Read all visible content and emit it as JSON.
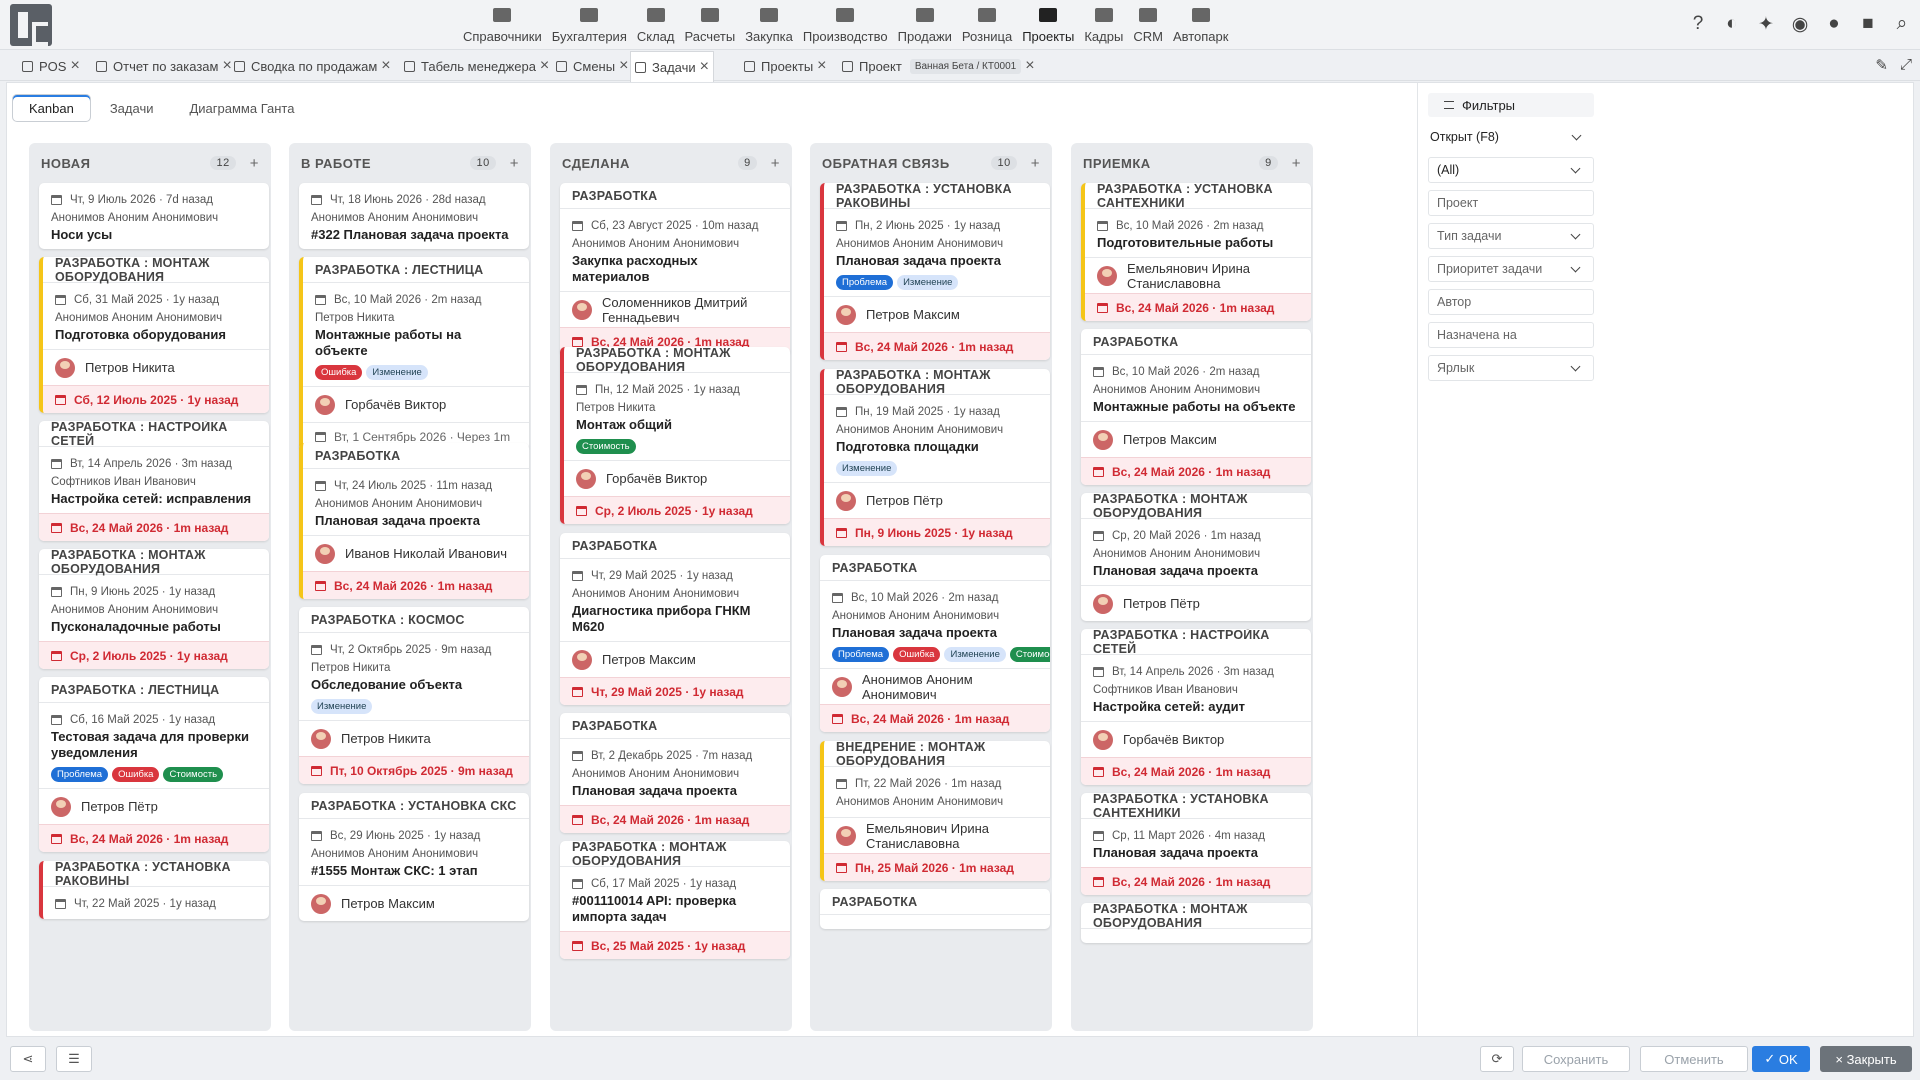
{
  "nav": {
    "modules": [
      {
        "label": "Справочники",
        "icon": "list-icon"
      },
      {
        "label": "Бухгалтерия",
        "icon": "ledger-icon"
      },
      {
        "label": "Склад",
        "icon": "warehouse-icon"
      },
      {
        "label": "Расчеты",
        "icon": "money-icon"
      },
      {
        "label": "Закупка",
        "icon": "truck-icon"
      },
      {
        "label": "Производство",
        "icon": "factory-icon"
      },
      {
        "label": "Продажи",
        "icon": "hand-money-icon"
      },
      {
        "label": "Розница",
        "icon": "bag-icon"
      },
      {
        "label": "Проекты",
        "icon": "project-icon",
        "active": true
      },
      {
        "label": "Кадры",
        "icon": "fingerprint-icon"
      },
      {
        "label": "CRM",
        "icon": "crm-icon"
      },
      {
        "label": "Автопарк",
        "icon": "bus-icon"
      }
    ],
    "tools": [
      "help-icon",
      "contrast-icon",
      "pin-icon",
      "eye-icon",
      "chat-icon",
      "lock-icon",
      "search-icon"
    ]
  },
  "tabs": [
    {
      "label": "POS"
    },
    {
      "label": "Отчет по заказам"
    },
    {
      "label": "Сводка по продажам"
    },
    {
      "label": "Табель менеджера"
    },
    {
      "label": "Смены"
    },
    {
      "label": "Задачи",
      "active": true
    },
    {
      "label": "Проекты"
    },
    {
      "label": "Проект",
      "badge": "Ванная Бета / КТ0001"
    }
  ],
  "views": {
    "kanban": "Kanban",
    "tasks": "Задачи",
    "gantt": "Диаграмма Ганта"
  },
  "columns": [
    {
      "title": "НОВАЯ",
      "count": "12",
      "add": "+",
      "cards": [
        {
          "type": "",
          "date": "Чт, 9 Июль 2026 · 7d назад",
          "author": "Анонимов Аноним Анонимович",
          "name": "Носи усы"
        },
        {
          "type": "РАЗРАБОТКА : МОНТАЖ ОБОРУДОВАНИЯ",
          "border": "yellow",
          "date": "Сб, 31 Май 2025 · 1y назад",
          "author": "Анонимов Аноним Анонимович",
          "name": "Подготовка оборудования",
          "assignee": "Петров Никита",
          "due": "Сб, 12 Июль 2025 · 1y назад"
        },
        {
          "type": "РАЗРАБОТКА : НАСТРОЙКА СЕТЕЙ",
          "date": "Вт, 14 Апрель 2026 · 3m назад",
          "author": "Софтников Иван Иванович",
          "name": "Настройка сетей: исправления",
          "due": "Вс, 24 Май 2026 · 1m назад"
        },
        {
          "type": "РАЗРАБОТКА : МОНТАЖ ОБОРУДОВАНИЯ",
          "date": "Пн, 9 Июнь 2025 · 1y назад",
          "author": "Анонимов Аноним Анонимович",
          "name": "Пусконаладочные работы",
          "due": "Ср, 2 Июль 2025 · 1y назад"
        },
        {
          "type": "РАЗРАБОТКА : ЛЕСТНИЦА",
          "date": "Сб, 16 Май 2025 · 1y назад",
          "author": "",
          "name": "Тестовая задача для проверки уведомления",
          "tags": [
            "Проблема",
            "Ошибка",
            "Стоимость"
          ],
          "assignee": "Петров Пётр",
          "due": "Вс, 24 Май 2026 · 1m назад"
        },
        {
          "type": "РАЗРАБОТКА : УСТАНОВКА РАКОВИНЫ",
          "border": "red",
          "date": "Чт, 22 Май 2025 · 1y назад",
          "author": "",
          "name": ""
        }
      ]
    },
    {
      "title": "В РАБОТЕ",
      "count": "10",
      "add": "+",
      "cards": [
        {
          "type": "",
          "date": "Чт, 18 Июнь 2026 · 28d назад",
          "author": "Анонимов Аноним Анонимович",
          "name": "#322 Плановая задача проекта"
        },
        {
          "type": "РАЗРАБОТКА : ЛЕСТНИЦА",
          "border": "yellow",
          "date": "Вс, 10 Май 2026 · 2m назад",
          "author": "Петров Никита",
          "name": "Монтажные работы на объекте",
          "tags": [
            "Ошибка",
            "Изменение"
          ],
          "assignee": "Горбачёв Виктор",
          "plan": "Вт, 1 Сентябрь 2026 · Через 1m"
        },
        {
          "type": "РАЗРАБОТКА",
          "border": "yellow",
          "date": "Чт, 24 Июль 2025 · 11m назад",
          "author": "Анонимов Аноним Анонимович",
          "name": "Плановая задача проекта",
          "assignee": "Иванов Николай Иванович",
          "due": "Вс, 24 Май 2026 · 1m назад"
        },
        {
          "type": "РАЗРАБОТКА : КОСМОС",
          "date": "Чт, 2 Октябрь 2025 · 9m назад",
          "author": "Петров Никита",
          "name": "Обследование объекта",
          "tags": [
            "Изменение"
          ],
          "assignee": "Петров Никита",
          "due": "Пт, 10 Октябрь 2025 · 9m назад"
        },
        {
          "type": "РАЗРАБОТКА : УСТАНОВКА СКС",
          "date": "Вс, 29 Июнь 2025 · 1y назад",
          "author": "Анонимов Аноним Анонимович",
          "name": "#1555 Монтаж СКС: 1 этап",
          "assignee": "Петров Максим"
        }
      ]
    },
    {
      "title": "СДЕЛАНА",
      "count": "9",
      "add": "+",
      "cards": [
        {
          "type": "РАЗРАБОТКА",
          "date": "Сб, 23 Август 2025 · 10m назад",
          "author": "Анонимов Аноним Анонимович",
          "name": "Закупка расходных материалов",
          "assignee": "Соломенников Дмитрий Геннадьевич",
          "due": "Вс, 24 Май 2026 · 1m назад"
        },
        {
          "type": "РАЗРАБОТКА : МОНТАЖ ОБОРУДОВАНИЯ",
          "border": "red",
          "date": "Пн, 12 Май 2025 · 1y назад",
          "author": "Петров Никита",
          "name": "Монтаж общий",
          "tags": [
            "Стоимость"
          ],
          "assignee": "Горбачёв Виктор",
          "due": "Ср, 2 Июль 2025 · 1y назад"
        },
        {
          "type": "РАЗРАБОТКА",
          "date": "Чт, 29 Май 2025 · 1y назад",
          "author": "Анонимов Аноним Анонимович",
          "name": "Диагностика прибора ГНКМ М620",
          "assignee": "Петров Максим",
          "due": "Чт, 29 Май 2025 · 1y назад"
        },
        {
          "type": "РАЗРАБОТКА",
          "date": "Вт, 2 Декабрь 2025 · 7m назад",
          "author": "Анонимов Аноним Анонимович",
          "name": "Плановая задача проекта",
          "due": "Вс, 24 Май 2026 · 1m назад"
        },
        {
          "type": "РАЗРАБОТКА : МОНТАЖ ОБОРУДОВАНИЯ",
          "date": "Сб, 17 Май 2025 · 1y назад",
          "author": "",
          "name": "#001110014 API: проверка импорта задач",
          "due": "Вс, 25 Май 2025 · 1y назад"
        }
      ]
    },
    {
      "title": "ОБРАТНАЯ СВЯЗЬ",
      "count": "10",
      "add": "+",
      "cards": [
        {
          "type": "РАЗРАБОТКА : УСТАНОВКА РАКОВИНЫ",
          "border": "red",
          "date": "Пн, 2 Июнь 2025 · 1y назад",
          "author": "Анонимов Аноним Анонимович",
          "name": "Плановая задача проекта",
          "tags": [
            "Проблема",
            "Изменение"
          ],
          "assignee": "Петров Максим",
          "due": "Вс, 24 Май 2026 · 1m назад"
        },
        {
          "type": "РАЗРАБОТКА : МОНТАЖ ОБОРУДОВАНИЯ",
          "border": "red",
          "date": "Пн, 19 Май 2025 · 1y назад",
          "author": "Анонимов Аноним Анонимович",
          "name": "Подготовка площадки",
          "tags": [
            "Изменение"
          ],
          "assignee": "Петров Пётр",
          "due": "Пн, 9 Июнь 2025 · 1y назад"
        },
        {
          "type": "РАЗРАБОТКА",
          "date": "Вс, 10 Май 2026 · 2m назад",
          "author": "Анонимов Аноним Анонимович",
          "name": "Плановая задача проекта",
          "tags": [
            "Проблема",
            "Ошибка",
            "Изменение",
            "Стоимость"
          ],
          "assignee": "Анонимов Аноним Анонимович",
          "due": "Вс, 24 Май 2026 · 1m назад"
        },
        {
          "type": "ВНЕДРЕНИЕ : МОНТАЖ ОБОРУДОВАНИЯ",
          "border": "yellow",
          "date": "Пт, 22 Май 2026 · 1m назад",
          "author": "Анонимов Аноним Анонимович",
          "name": "",
          "assignee": "Емельянович Ирина Станиславовна",
          "due": "Пн, 25 Май 2026 · 1m назад"
        },
        {
          "type": "РАЗРАБОТКА",
          "date": "",
          "author": "",
          "name": ""
        }
      ]
    },
    {
      "title": "ПРИЕМКА",
      "count": "9",
      "add": "+",
      "cards": [
        {
          "type": "РАЗРАБОТКА : УСТАНОВКА САНТЕХНИКИ",
          "border": "yellow",
          "date": "Вс, 10 Май 2026 · 2m назад",
          "author": "",
          "name": "Подготовительные работы",
          "assignee": "Емельянович Ирина Станиславовна",
          "due": "Вс, 24 Май 2026 · 1m назад"
        },
        {
          "type": "РАЗРАБОТКА",
          "date": "Вс, 10 Май 2026 · 2m назад",
          "author": "Анонимов Аноним Анонимович",
          "name": "Монтажные работы на объекте",
          "assignee": "Петров Максим",
          "due": "Вс, 24 Май 2026 · 1m назад"
        },
        {
          "type": "РАЗРАБОТКА : МОНТАЖ ОБОРУДОВАНИЯ",
          "date": "Ср, 20 Май 2026 · 1m назад",
          "author": "Анонимов Аноним Анонимович",
          "name": "Плановая задача проекта",
          "assignee": "Петров Пётр"
        },
        {
          "type": "РАЗРАБОТКА : НАСТРОЙКА СЕТЕЙ",
          "date": "Вт, 14 Апрель 2026 · 3m назад",
          "author": "Софтников Иван Иванович",
          "name": "Настройка сетей: аудит",
          "assignee": "Горбачёв Виктор",
          "due": "Вс, 24 Май 2026 · 1m назад"
        },
        {
          "type": "РАЗРАБОТКА : УСТАНОВКА САНТЕХНИКИ",
          "date": "Ср, 11 Март 2026 · 4m назад",
          "author": "",
          "name": "Плановая задача проекта",
          "due": "Вс, 24 Май 2026 · 1m назад"
        },
        {
          "type": "РАЗРАБОТКА : МОНТАЖ ОБОРУДОВАНИЯ",
          "date": "",
          "author": "",
          "name": ""
        }
      ]
    }
  ],
  "filters": {
    "header": "Фильтры",
    "status": "Открыт (F8)",
    "all": "(All)",
    "project": "Проект",
    "task_type": "Тип задачи",
    "priority": "Приоритет задачи",
    "author": "Автор",
    "assigned": "Назначена на",
    "label": "Ярлык"
  },
  "footer": {
    "save": "Сохранить",
    "cancel": "Отменить",
    "ok": "OK",
    "close": "Закрыть"
  },
  "colors": {
    "accent": "#2a7de1",
    "due": "#d02a33",
    "problem": "#1f6fd6",
    "error": "#d9363e",
    "change": "#d6e4fa",
    "cost": "#1f8f4e"
  }
}
